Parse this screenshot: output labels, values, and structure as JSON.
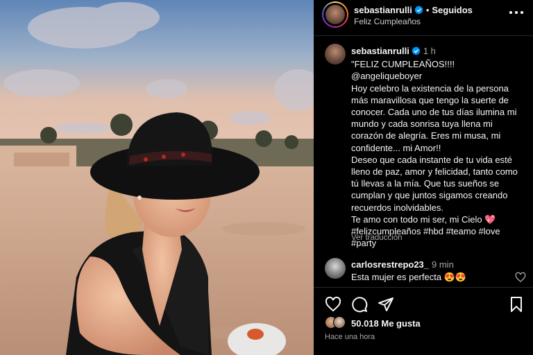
{
  "post": {
    "username": "sebastianrulli",
    "follow_status": "Seguidos",
    "subtitle": "Feliz Cumpleaños",
    "caption_time": "1 h",
    "caption_lines": [
      "\"FELIZ CUMPLEAÑOS!!!! @angeliqueboyer",
      "Hoy celebro la existencia de la persona más maravillosa que tengo la suerte de conocer. Cada uno de tus días ilumina mi mundo y cada sonrisa tuya llena mi corazón de alegría. Eres mi musa, mi confidente... mi Amor!!",
      "Deseo que cada instante de tu vida esté lleno de paz, amor y felicidad, tanto como tú llevas a la mía. Que tus sueños se cumplan y que juntos sigamos creando recuerdos inolvidables.",
      "Te amo con todo mi ser, mi Cielo 💖",
      "#felizcumpleaños #hbd #teamo #love #party"
    ],
    "see_translation": "Ver traducción"
  },
  "comment": {
    "username": "carlosrestrepo23_",
    "time": "9 min",
    "text": "Esta mujer es perfecta 😍😍"
  },
  "footer": {
    "likes": "50.018 Me gusta",
    "time_ago": "Hace una hora"
  },
  "icons": {
    "verified": "verified-badge-icon",
    "more": "more-options-icon",
    "like": "heart-icon",
    "comment": "comment-icon",
    "share": "share-icon",
    "save": "bookmark-icon"
  },
  "colors": {
    "background": "#000000",
    "text": "#f5f5f5",
    "secondary": "#a8a8a8",
    "verified": "#0095f6",
    "divider": "#262626"
  }
}
